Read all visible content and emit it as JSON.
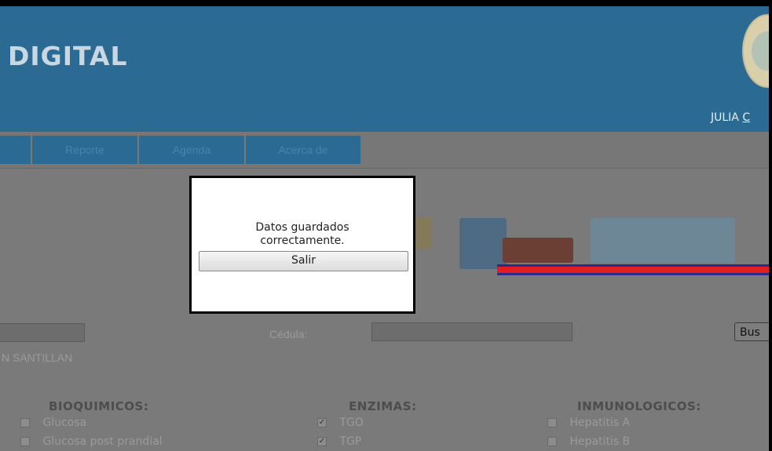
{
  "header": {
    "title": "DIGITAL",
    "user_name": "JULIA",
    "user_link": "C"
  },
  "nav": {
    "items": [
      {
        "label": ""
      },
      {
        "label": "Reporte"
      },
      {
        "label": "Agenda"
      },
      {
        "label": "Acerca de"
      }
    ]
  },
  "form": {
    "cedula_label": "Cédula:",
    "search_button": "Bus",
    "patient_name": "N SANTILLAN"
  },
  "sections": {
    "bioquimicos": {
      "title": "BIOQUIMICOS:",
      "items": [
        {
          "label": "Glucosa",
          "checked": false
        },
        {
          "label": "Glucosa post prandial",
          "checked": false
        }
      ]
    },
    "enzimas": {
      "title": "ENZIMAS:",
      "items": [
        {
          "label": "TGO",
          "checked": true
        },
        {
          "label": "TGP",
          "checked": true
        }
      ]
    },
    "inmunologicos": {
      "title": "INMUNOLOGICOS:",
      "items": [
        {
          "label": "Hepatitis A",
          "checked": false
        },
        {
          "label": "Hepatitis B",
          "checked": false
        }
      ]
    }
  },
  "dialog": {
    "message_line1": "Datos guardados",
    "message_line2": "correctamente.",
    "button": "Salir"
  },
  "colors": {
    "header_bg": "#2a6a93",
    "overlay_gray": "#7a7a7a",
    "accent_red": "#e21d22"
  }
}
